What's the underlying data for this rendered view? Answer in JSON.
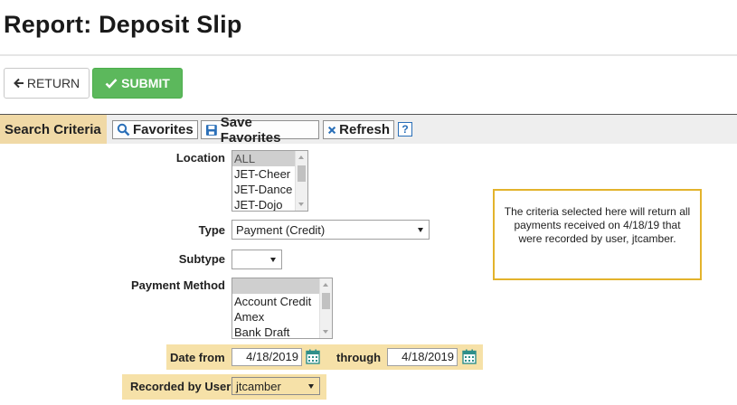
{
  "page": {
    "title": "Report: Deposit Slip"
  },
  "actions": {
    "return_label": "RETURN",
    "submit_label": "SUBMIT"
  },
  "criteria_bar": {
    "label": "Search Criteria",
    "favorites_label": "Favorites",
    "save_favorites_label": "Save Favorites",
    "refresh_label": "Refresh",
    "help_label": "?"
  },
  "form": {
    "location": {
      "label": "Location",
      "options": [
        "ALL",
        "JET-Cheer",
        "JET-Dance",
        "JET-Dojo"
      ],
      "selected": "ALL"
    },
    "type": {
      "label": "Type",
      "value": "Payment (Credit)"
    },
    "subtype": {
      "label": "Subtype",
      "value": ""
    },
    "payment_method": {
      "label": "Payment Method",
      "options": [
        "",
        "Account Credit",
        "Amex",
        "Bank Draft"
      ]
    },
    "date_from": {
      "label": "Date from",
      "value": "4/18/2019"
    },
    "date_through": {
      "label": "through",
      "value": "4/18/2019"
    },
    "recorded_by": {
      "label": "Recorded by User",
      "value": "jtcamber"
    }
  },
  "note": {
    "text": "The criteria selected here will return all payments received on 4/18/19 that were recorded by user, jtcamber."
  },
  "icons": {
    "return": "arrow-left-icon",
    "submit": "checkmark-icon",
    "favorites": "search-icon",
    "save": "floppy-disk-icon",
    "refresh": "x-icon",
    "help": "help-icon",
    "calendar": "calendar-icon"
  },
  "colors": {
    "submit_green": "#5cb85c",
    "criteria_label_bg": "#f0d9a6",
    "highlight_band": "#f6e1a8",
    "note_border": "#e3b32c",
    "link_blue": "#2a6fb8",
    "calendar_teal": "#2f8f8a"
  }
}
